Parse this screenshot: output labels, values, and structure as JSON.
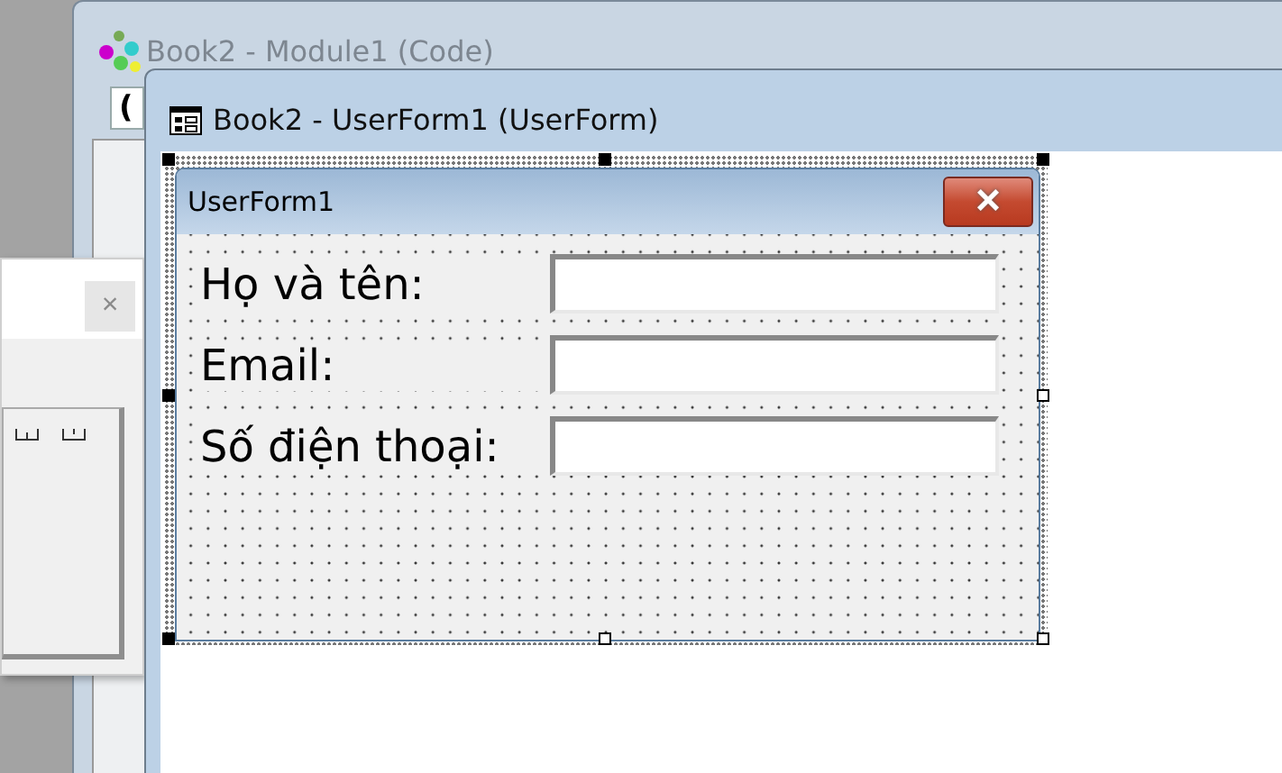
{
  "code_window": {
    "title": "Book2 - Module1 (Code)",
    "object_box": "("
  },
  "side_dialog": {
    "close": "×"
  },
  "designer_window": {
    "title": "Book2 - UserForm1 (UserForm)"
  },
  "userform": {
    "title": "UserForm1",
    "close": "×",
    "fields": [
      {
        "label": "Họ và tên:"
      },
      {
        "label": "Email:"
      },
      {
        "label": "Số điện thoại:"
      }
    ]
  }
}
